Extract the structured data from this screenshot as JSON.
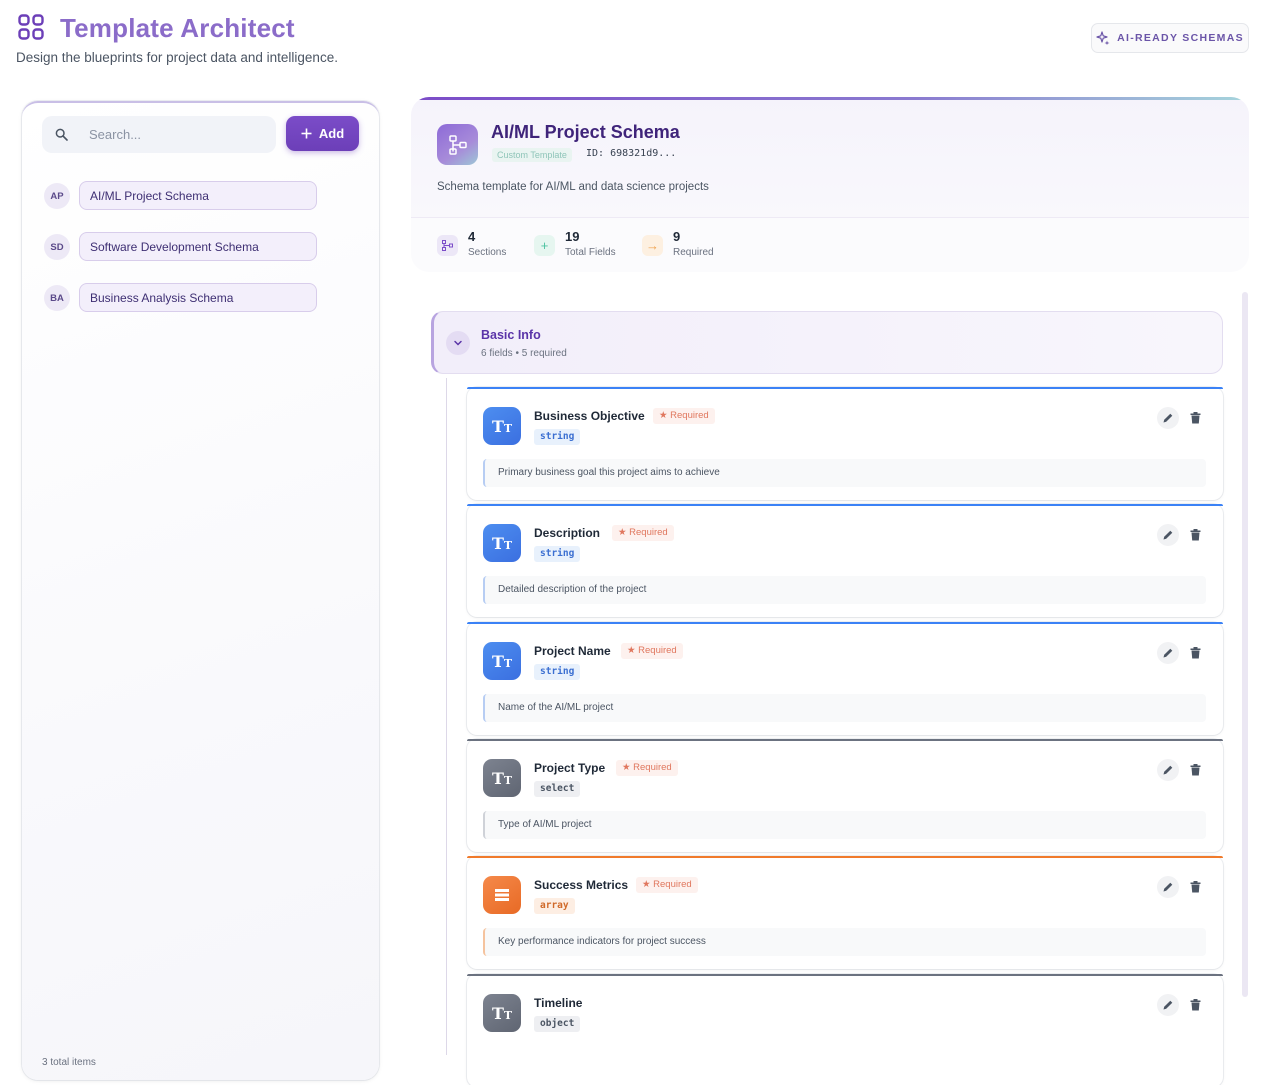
{
  "header": {
    "title": "Template Architect",
    "subtitle": "Design the blueprints for project data and intelligence.",
    "ai_badge": "AI-READY SCHEMAS",
    "accent": "#7b4cc8"
  },
  "sidebar": {
    "search_placeholder": "Search...",
    "add_label": "Add",
    "items": [
      {
        "initials": "AP",
        "label": "AI/ML Project Schema"
      },
      {
        "initials": "SD",
        "label": "Software Development Schema"
      },
      {
        "initials": "BA",
        "label": "Business Analysis Schema"
      }
    ],
    "total": "3 total items"
  },
  "schema": {
    "title": "AI/ML Project Schema",
    "badge": "Custom Template",
    "id": "ID: 698321d9...",
    "description": "Schema template for AI/ML and data science projects",
    "stats": [
      {
        "value": "4",
        "label": "Sections",
        "icon": "hierarchy-icon",
        "color": "#7b4cc8"
      },
      {
        "value": "19",
        "label": "Total Fields",
        "icon": "plus-icon",
        "color": "#4cc2a0"
      },
      {
        "value": "9",
        "label": "Required",
        "icon": "arrow-right-icon",
        "color": "#f0a04b"
      }
    ]
  },
  "section": {
    "title": "Basic Info",
    "meta": "6 fields • 5 required"
  },
  "fields": [
    {
      "name": "Business Objective",
      "required": "★ Required",
      "type": "string",
      "description": "Primary business goal this project aims to achieve",
      "color": "#3b82f6"
    },
    {
      "name": "Description",
      "required": "★ Required",
      "type": "string",
      "description": "Detailed description of the project",
      "color": "#3b82f6"
    },
    {
      "name": "Project Name",
      "required": "★ Required",
      "type": "string",
      "description": "Name of the AI/ML project",
      "color": "#3b82f6"
    },
    {
      "name": "Project Type",
      "required": "★ Required",
      "type": "select",
      "description": "Type of AI/ML project",
      "color": "#6b7280"
    },
    {
      "name": "Success Metrics",
      "required": "★ Required",
      "type": "array",
      "description": "Key performance indicators for project success",
      "color": "#f07a2b"
    },
    {
      "name": "Timeline",
      "required": "",
      "type": "object",
      "description": "",
      "color": "#6b7280"
    }
  ]
}
